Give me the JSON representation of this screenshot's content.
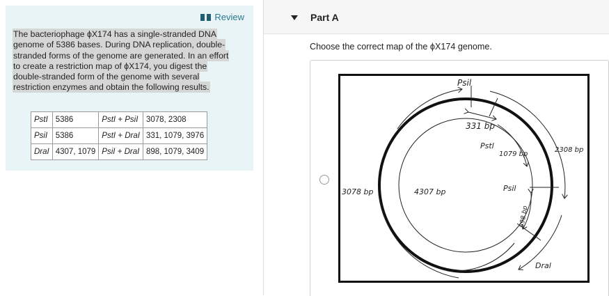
{
  "left": {
    "review_label": "Review",
    "problem": [
      "The bacteriophage ϕX174 has a single-stranded DNA",
      "genome of 5386 bases. During DNA replication, double-",
      "stranded forms of the genome are generated. In an effort",
      "to create a restriction map of ϕX174, you digest the",
      "double-stranded form of the genome with several",
      "restriction enzymes and obtain the following results."
    ],
    "table": [
      [
        "PstI",
        "5386",
        "PstI + PsiI",
        "3078, 2308"
      ],
      [
        "PsiI",
        "5386",
        "PstI + DraI",
        "331, 1079, 3976"
      ],
      [
        "DraI",
        "4307, 1079",
        "PsiI + DraI",
        "898, 1079, 3409"
      ]
    ]
  },
  "part": {
    "title": "Part A",
    "question": "Choose the correct map of the ϕX174 genome."
  },
  "map": {
    "psil_top": "Psil",
    "bp331": "331 bp",
    "pstl": "Pstl",
    "bp1079": "1079 bp",
    "bp2308": "2308 bp",
    "bp3078": "3078 bp",
    "bp4307": "4307 bp",
    "psil_right": "Psil",
    "bp898": "898 bp",
    "dral": "Dral"
  }
}
